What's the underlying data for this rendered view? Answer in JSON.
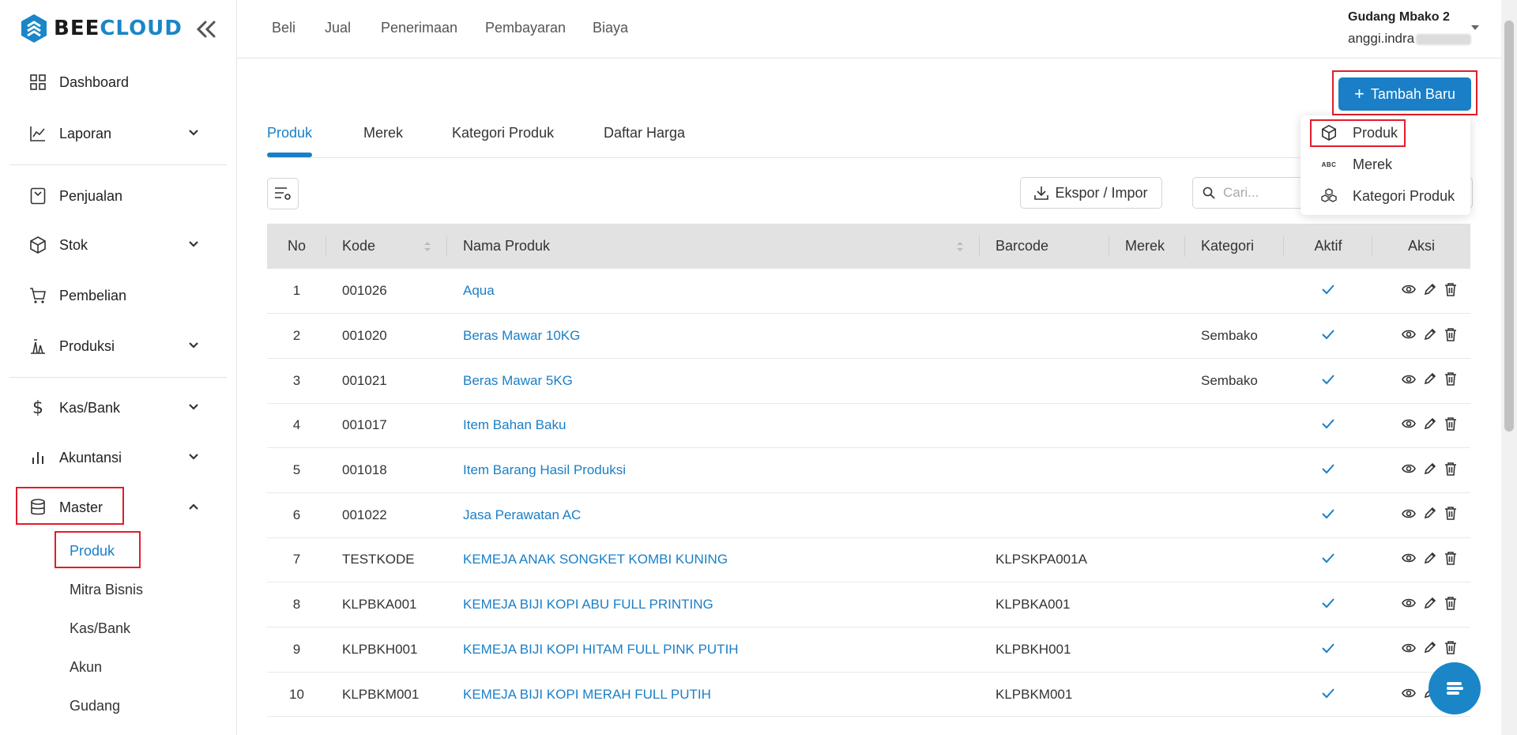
{
  "brand": {
    "name_part1": "BEE",
    "name_part2": "CLOUD",
    "color": "#1a86c7"
  },
  "sidebar": {
    "items": [
      {
        "label": "Dashboard",
        "icon": "dashboard-icon"
      },
      {
        "label": "Laporan",
        "icon": "chart-line-icon",
        "expandable": true
      },
      {
        "label": "Penjualan",
        "icon": "receipt-icon"
      },
      {
        "label": "Stok",
        "icon": "box-icon",
        "expandable": true
      },
      {
        "label": "Pembelian",
        "icon": "cart-icon"
      },
      {
        "label": "Produksi",
        "icon": "factory-icon",
        "expandable": true
      },
      {
        "label": "Kas/Bank",
        "icon": "dollar-icon",
        "expandable": true
      },
      {
        "label": "Akuntansi",
        "icon": "bar-chart-icon",
        "expandable": true
      },
      {
        "label": "Master",
        "icon": "database-icon",
        "expanded": true
      }
    ],
    "master_sub": [
      "Produk",
      "Mitra Bisnis",
      "Kas/Bank",
      "Akun",
      "Gudang"
    ]
  },
  "topnav": {
    "items": [
      "Beli",
      "Jual",
      "Penerimaan",
      "Pembayaran",
      "Biaya"
    ]
  },
  "user": {
    "warehouse": "Gudang Mbako 2",
    "email_visible": "anggi.indra"
  },
  "toolbar": {
    "add_label": "Tambah Baru",
    "export_label": "Ekspor / Impor",
    "search_placeholder": "Cari..."
  },
  "tabs": [
    "Produk",
    "Merek",
    "Kategori Produk",
    "Daftar Harga"
  ],
  "dropdown": [
    {
      "label": "Produk",
      "icon": "cube-icon"
    },
    {
      "label": "Merek",
      "icon": "abc-icon"
    },
    {
      "label": "Kategori Produk",
      "icon": "boxes-icon"
    }
  ],
  "table": {
    "headers": [
      "No",
      "Kode",
      "Nama Produk",
      "Barcode",
      "Merek",
      "Kategori",
      "Aktif",
      "Aksi"
    ],
    "rows": [
      {
        "no": "1",
        "kode": "001026",
        "nama": "Aqua",
        "barcode": "",
        "merek": "",
        "kategori": ""
      },
      {
        "no": "2",
        "kode": "001020",
        "nama": "Beras Mawar 10KG",
        "barcode": "",
        "merek": "",
        "kategori": "Sembako"
      },
      {
        "no": "3",
        "kode": "001021",
        "nama": "Beras Mawar 5KG",
        "barcode": "",
        "merek": "",
        "kategori": "Sembako"
      },
      {
        "no": "4",
        "kode": "001017",
        "nama": "Item Bahan Baku",
        "barcode": "",
        "merek": "",
        "kategori": ""
      },
      {
        "no": "5",
        "kode": "001018",
        "nama": "Item Barang Hasil Produksi",
        "barcode": "",
        "merek": "",
        "kategori": ""
      },
      {
        "no": "6",
        "kode": "001022",
        "nama": "Jasa Perawatan AC",
        "barcode": "",
        "merek": "",
        "kategori": ""
      },
      {
        "no": "7",
        "kode": "TESTKODE",
        "nama": "KEMEJA ANAK SONGKET KOMBI KUNING",
        "barcode": "KLPSKPA001A",
        "merek": "",
        "kategori": ""
      },
      {
        "no": "8",
        "kode": "KLPBKA001",
        "nama": "KEMEJA BIJI KOPI ABU FULL PRINTING",
        "barcode": "KLPBKA001",
        "merek": "",
        "kategori": ""
      },
      {
        "no": "9",
        "kode": "KLPBKH001",
        "nama": "KEMEJA BIJI KOPI HITAM FULL PINK PUTIH",
        "barcode": "KLPBKH001",
        "merek": "",
        "kategori": ""
      },
      {
        "no": "10",
        "kode": "KLPBKM001",
        "nama": "KEMEJA BIJI KOPI MERAH FULL PUTIH",
        "barcode": "KLPBKM001",
        "merek": "",
        "kategori": ""
      }
    ]
  },
  "colors": {
    "accent": "#1a7fc7",
    "highlight": "#e11d2b",
    "header_bg": "#e2e2e2"
  }
}
